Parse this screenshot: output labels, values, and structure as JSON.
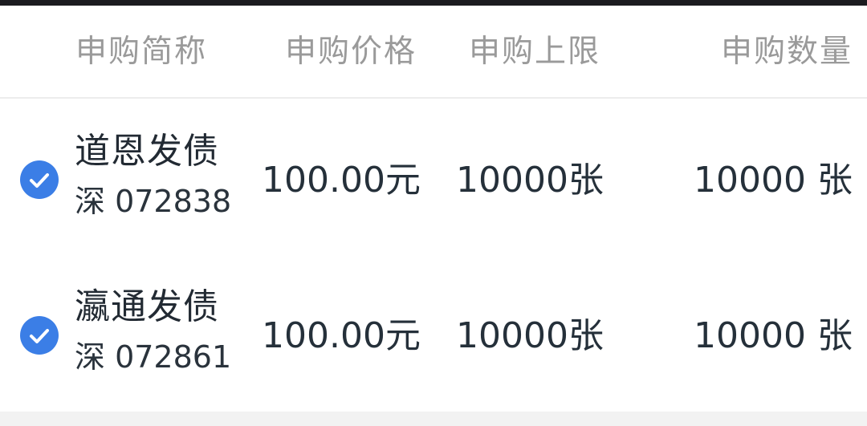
{
  "header": {
    "col_name": "申购简称",
    "col_price": "申购价格",
    "col_limit": "申购上限",
    "col_qty": "申购数量"
  },
  "accent_color": "#3b7ee6",
  "rows": [
    {
      "checked": true,
      "name": "道恩发债",
      "code": "深 072838",
      "price": "100.00元",
      "limit": "10000张",
      "qty": "10000 张"
    },
    {
      "checked": true,
      "name": "瀛通发债",
      "code": "深 072861",
      "price": "100.00元",
      "limit": "10000张",
      "qty": "10000 张"
    }
  ],
  "icons": {
    "check": "check-circle-icon"
  }
}
